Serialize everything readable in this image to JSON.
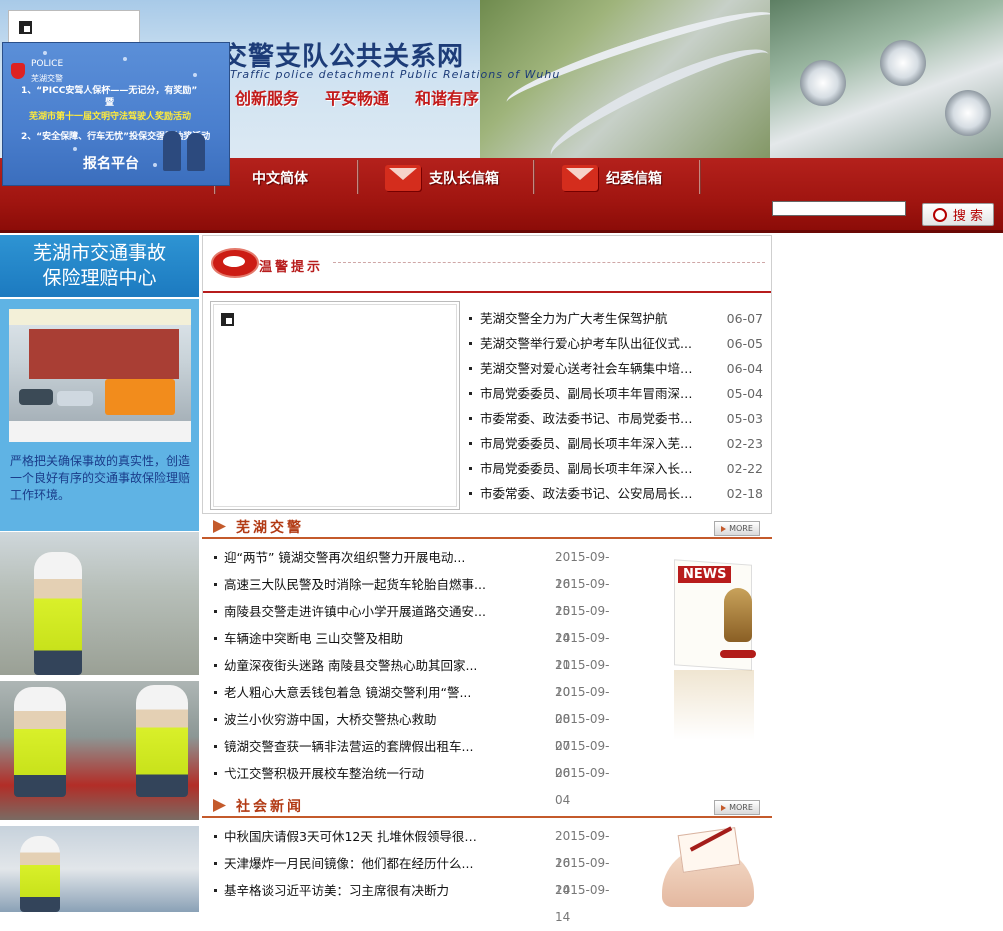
{
  "banner": {
    "site_title": "芜湖市交警支队公共关系网",
    "site_subtitle": "Traffic police detachment Public Relations of Wuhu",
    "slogans": [
      "创新服务",
      "平安畅通",
      "和谐有序"
    ]
  },
  "popup_ad": {
    "badge_text": "POLICE",
    "badge_sub": "芜湖交警",
    "line1": "1、“PICC安驾人保杯——无记分，有奖励”",
    "line1b": "暨",
    "line2": "芜湖市第十一届文明守法驾驶人奖励活动",
    "line3": "2、“安全保障、行车无忧”投保交强险抽奖活动",
    "button": "报名平台"
  },
  "nav": {
    "items": [
      {
        "label": "中文简体"
      },
      {
        "label": "支队长信箱"
      },
      {
        "label": "纪委信箱"
      }
    ],
    "search_placeholder": "",
    "search_button": "搜 索"
  },
  "sidebar": {
    "insurance_title_line1": "芜湖市交通事故",
    "insurance_title_line2": "保险理赔中心",
    "insurance_text": "严格把关确保事故的真实性，创造一个良好有序的交通事故保险理赔工作环境。"
  },
  "notice": {
    "title": "温警提示",
    "items": [
      {
        "title": "芜湖交警全力为广大考生保驾护航",
        "date": "06-07"
      },
      {
        "title": "芜湖交警举行爱心护考车队出征仪式...",
        "date": "06-05"
      },
      {
        "title": "芜湖交警对爱心送考社会车辆集中培训...",
        "date": "06-04"
      },
      {
        "title": "市局党委委员、副局长项丰年冒雨深入...",
        "date": "05-04"
      },
      {
        "title": "市委常委、政法委书记、市局党委书记...",
        "date": "05-03"
      },
      {
        "title": "市局党委委员、副局长项丰年深入芜宣...",
        "date": "02-23"
      },
      {
        "title": "市局党委委员、副局长项丰年深入长江...",
        "date": "02-22"
      },
      {
        "title": "市委常委、政法委书记、公安局局长张...",
        "date": "02-18"
      }
    ]
  },
  "wuhu_police": {
    "title": "芜湖交警",
    "more": "MORE",
    "graphic_tag": "NEWS",
    "items": [
      {
        "title": "迎“两节” 镜湖交警再次组织警力开展电动...",
        "date": "2015-09-16"
      },
      {
        "title": "高速三大队民警及时消除一起货车轮胎自燃事...",
        "date": "2015-09-15"
      },
      {
        "title": "南陵县交警走进许镇中心小学开展道路交通安...",
        "date": "2015-09-14"
      },
      {
        "title": "车辆途中突断电 三山交警及相助",
        "date": "2015-09-11"
      },
      {
        "title": "幼童深夜街头迷路 南陵县交警热心助其回家...",
        "date": "2015-09-10"
      },
      {
        "title": "老人粗心大意丢钱包着急 镜湖交警利用“警...",
        "date": "2015-09-08"
      },
      {
        "title": "波兰小伙穷游中国，大桥交警热心救助",
        "date": "2015-09-07"
      },
      {
        "title": "镜湖交警查获一辆非法营运的套牌假出租车...",
        "date": "2015-09-06"
      },
      {
        "title": "弋江交警积极开展校车整治统一行动",
        "date": "2015-09-04"
      }
    ]
  },
  "social_news": {
    "title": "社会新闻",
    "more": "MORE",
    "items": [
      {
        "title": "中秋国庆请假3天可休12天 扎堆休假领导很愁...",
        "date": "2015-09-16"
      },
      {
        "title": "天津爆炸一月民间镜像：他们都在经历什么...",
        "date": "2015-09-14"
      },
      {
        "title": "基辛格谈习近平访美：习主席很有决断力",
        "date": "2015-09-14"
      }
    ]
  },
  "colors": {
    "nav_red": "#a01510",
    "sidebar_blue": "#2e94d3",
    "section_orange": "#c45a2b"
  }
}
